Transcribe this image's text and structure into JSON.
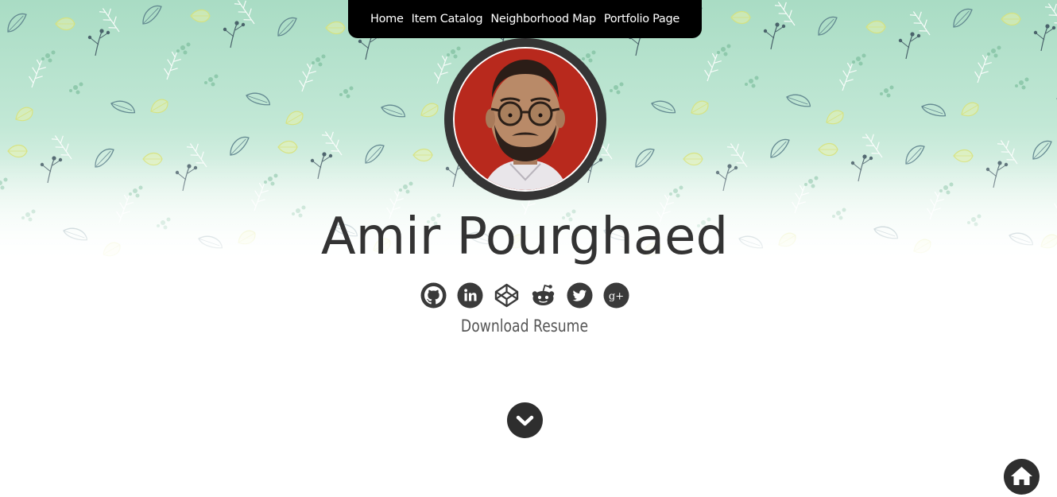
{
  "nav": {
    "items": [
      {
        "label": "Home"
      },
      {
        "label": "Item Catalog"
      },
      {
        "label": "Neighborhood Map"
      },
      {
        "label": "Portfolio Page"
      }
    ]
  },
  "profile": {
    "name": "Amir Pourghaed",
    "avatar_icon": "profile-photo"
  },
  "social": {
    "icons": [
      "github-icon",
      "linkedin-icon",
      "codepen-icon",
      "reddit-icon",
      "twitter-icon",
      "google-plus-icon"
    ],
    "google_plus_text": "g+"
  },
  "resume": {
    "label": "Download Resume"
  },
  "buttons": {
    "scroll_down_icon": "chevron-down-icon",
    "home_icon": "home-icon"
  },
  "colors": {
    "nav_bg": "#000000",
    "dark": "#333333",
    "header_mint": "#a9dcc4"
  }
}
